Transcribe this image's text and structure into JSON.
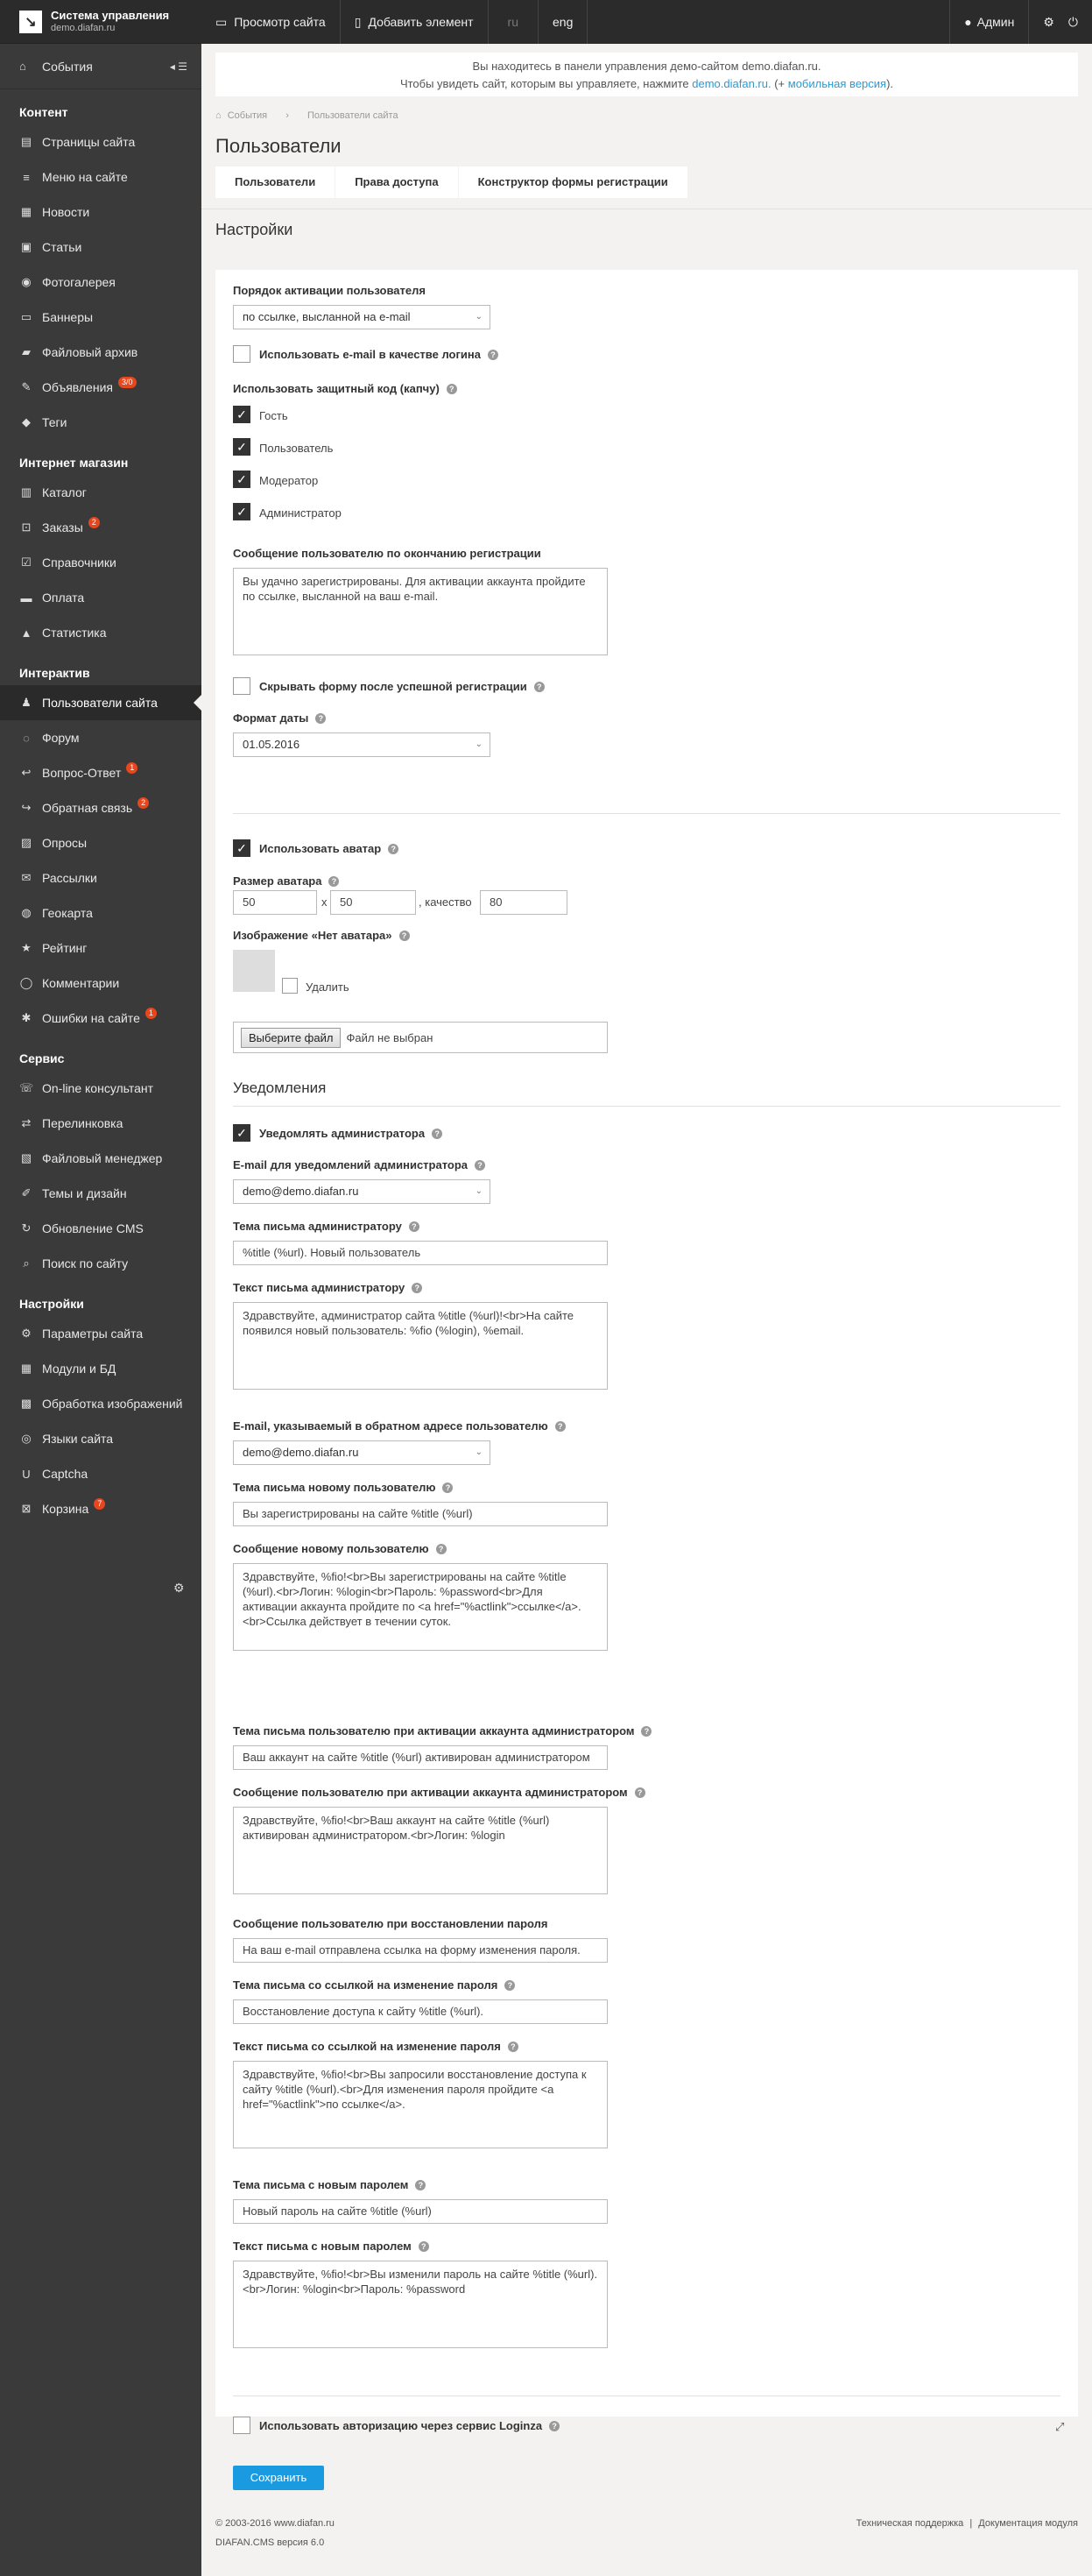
{
  "brand": {
    "title": "Система управления",
    "domain": "demo.diafan.ru"
  },
  "sidebar": {
    "events": "События",
    "sections": [
      {
        "title": "Контент",
        "items": [
          {
            "label": "Страницы сайта",
            "icon": "file-icon"
          },
          {
            "label": "Меню на сайте",
            "icon": "menu-icon"
          },
          {
            "label": "Новости",
            "icon": "newspaper-icon"
          },
          {
            "label": "Статьи",
            "icon": "article-icon"
          },
          {
            "label": "Фотогалерея",
            "icon": "camera-icon"
          },
          {
            "label": "Баннеры",
            "icon": "banner-icon"
          },
          {
            "label": "Файловый архив",
            "icon": "folder-icon"
          },
          {
            "label": "Объявления",
            "icon": "ad-icon",
            "badge": "3/0"
          },
          {
            "label": "Теги",
            "icon": "tag-icon"
          }
        ]
      },
      {
        "title": "Интернет магазин",
        "items": [
          {
            "label": "Каталог",
            "icon": "catalog-icon"
          },
          {
            "label": "Заказы",
            "icon": "cart-icon",
            "badge": "2"
          },
          {
            "label": "Справочники",
            "icon": "check-square-icon"
          },
          {
            "label": "Оплата",
            "icon": "payment-icon"
          },
          {
            "label": "Статистика",
            "icon": "chart-icon"
          }
        ]
      },
      {
        "title": "Интерактив",
        "items": [
          {
            "label": "Пользователи сайта",
            "icon": "users-icon",
            "active": true
          },
          {
            "label": "Форум",
            "icon": "forum-icon"
          },
          {
            "label": "Вопрос-Ответ",
            "icon": "question-icon",
            "badge": "1"
          },
          {
            "label": "Обратная связь",
            "icon": "feedback-icon",
            "badge": "2"
          },
          {
            "label": "Опросы",
            "icon": "poll-icon"
          },
          {
            "label": "Рассылки",
            "icon": "mail-icon"
          },
          {
            "label": "Геокарта",
            "icon": "map-marker-icon"
          },
          {
            "label": "Рейтинг",
            "icon": "rating-icon"
          },
          {
            "label": "Комментарии",
            "icon": "comment-icon"
          },
          {
            "label": "Ошибки на сайте",
            "icon": "bug-icon",
            "badge": "1"
          }
        ]
      },
      {
        "title": "Сервис",
        "items": [
          {
            "label": "On-line консультант",
            "icon": "chat-icon"
          },
          {
            "label": "Перелинковка",
            "icon": "link-icon"
          },
          {
            "label": "Файловый менеджер",
            "icon": "files-icon"
          },
          {
            "label": "Темы и дизайн",
            "icon": "design-icon"
          },
          {
            "label": "Обновление CMS",
            "icon": "refresh-icon"
          },
          {
            "label": "Поиск по сайту",
            "icon": "search-icon"
          }
        ]
      },
      {
        "title": "Настройки",
        "items": [
          {
            "label": "Параметры сайта",
            "icon": "gears-icon"
          },
          {
            "label": "Модули и БД",
            "icon": "modules-icon"
          },
          {
            "label": "Обработка изображений",
            "icon": "image-icon"
          },
          {
            "label": "Языки сайта",
            "icon": "globe-icon"
          },
          {
            "label": "Captcha",
            "icon": "captcha-icon"
          },
          {
            "label": "Корзина",
            "icon": "trash-icon",
            "badge": "7"
          }
        ]
      }
    ]
  },
  "topbar": {
    "view_site": "Просмотр сайта",
    "add_element": "Добавить элемент",
    "lang_ru": "ru",
    "lang_en": "eng",
    "admin": "Админ"
  },
  "notice": {
    "line1": "Вы находитесь в панели управления демо-сайтом demo.diafan.ru.",
    "line2_prefix": "Чтобы увидеть сайт, которым вы управляете, нажмите",
    "link1": "demo.diafan.ru.",
    "line2_mid": "(+",
    "link2": "мобильная версия",
    "line2_end": ")."
  },
  "breadcrumb": {
    "home": "События",
    "current": "Пользователи сайта"
  },
  "page_title": "Пользователи",
  "tabs": [
    "Пользователи",
    "Права доступа",
    "Конструктор формы регистрации"
  ],
  "settings_title": "Настройки",
  "form": {
    "activation_label": "Порядок активации пользователя",
    "activation_value": "по ссылке, высланной на e-mail",
    "email_login_label": "Использовать e-mail в качестве логина",
    "captcha_label": "Использовать защитный код (капчу)",
    "captcha_roles": [
      "Гость",
      "Пользователь",
      "Модератор",
      "Администратор"
    ],
    "reg_msg_label": "Сообщение пользователю по окончанию регистрации",
    "reg_msg_value": "Вы удачно зарегистрированы. Для активации аккаунта пройдите по ссылке, высланной на ваш e-mail.",
    "hide_form_label": "Скрывать форму после успешной регистрации",
    "date_format_label": "Формат даты",
    "date_format_value": "01.05.2016",
    "use_avatar_label": "Использовать аватар",
    "avatar_size_label": "Размер аватара",
    "avatar_w": "50",
    "avatar_x": "x",
    "avatar_h": "50",
    "avatar_quality_label": ", качество",
    "avatar_quality": "80",
    "no_avatar_label": "Изображение «Нет аватара»",
    "delete_label": "Удалить",
    "file_button": "Выберите файл",
    "file_status": "Файл не выбран",
    "notifications_title": "Уведомления",
    "notify_admin_label": "Уведомлять администратора",
    "admin_email_label": "E-mail для уведомлений администратора",
    "admin_email_value": "demo@demo.diafan.ru",
    "admin_subject_label": "Тема письма администратору",
    "admin_subject_value": "%title (%url). Новый пользователь",
    "admin_text_label": "Текст письма администратору",
    "admin_text_value": "Здравствуйте, администратор сайта %title (%url)!<br>На сайте появился новый пользователь: %fio (%login), %email.",
    "reply_email_label": "E-mail, указываемый в обратном адресе пользователю",
    "reply_email_value": "demo@demo.diafan.ru",
    "new_user_subject_label": "Тема письма новому пользователю",
    "new_user_subject_value": "Вы зарегистрированы на сайте %title (%url)",
    "new_user_msg_label": "Сообщение новому пользователю",
    "new_user_msg_value": "Здравствуйте, %fio!<br>Вы зарегистрированы на сайте %title (%url).<br>Логин: %login<br>Пароль: %password<br>Для активации аккаунта пройдите по <a href=\"%actlink\">ссылке</a>.<br>Ссылка действует в течении суток.",
    "act_subject_label": "Тема письма пользователю при активации аккаунта администратором",
    "act_subject_value": "Ваш аккаунт на сайте %title (%url) активирован администратором",
    "act_msg_label": "Сообщение пользователю при активации аккаунта администратором",
    "act_msg_value": "Здравствуйте, %fio!<br>Ваш аккаунт на сайте %title (%url) активирован администратором.<br>Логин: %login",
    "restore_msg_label": "Сообщение пользователю при восстановлении пароля",
    "restore_msg_value": "На ваш e-mail отправлена ссылка на форму изменения пароля.",
    "link_subject_label": "Тема письма со ссылкой на изменение пароля",
    "link_subject_value": "Восстановление доступа к сайту %title (%url).",
    "link_text_label": "Текст письма со ссылкой на изменение пароля",
    "link_text_value": "Здравствуйте, %fio!<br>Вы запросили восстановление доступа к сайту %title (%url).<br>Для изменения пароля пройдите <a href=\"%actlink\">по ссылке</a>.",
    "newpass_subject_label": "Тема письма с новым паролем",
    "newpass_subject_value": "Новый пароль на сайте %title (%url)",
    "newpass_text_label": "Текст письма с новым паролем",
    "newpass_text_value": "Здравствуйте, %fio!<br>Вы изменили пароль на сайте %title (%url).<br>Логин: %login<br>Пароль: %password",
    "loginza_label": "Использовать авторизацию через сервис Loginza",
    "save_button": "Сохранить"
  },
  "footer": {
    "copyright": "© 2003-2016 www.diafan.ru",
    "version": "DIAFAN.CMS версия 6.0",
    "support": "Техническая поддержка",
    "sep": "|",
    "docs": "Документация модуля"
  }
}
